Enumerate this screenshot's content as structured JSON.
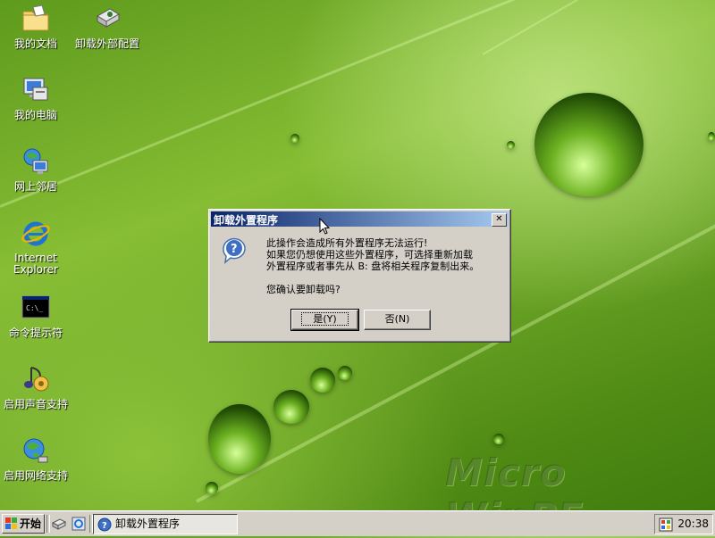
{
  "desktop": {
    "icons": [
      {
        "label": "我的文档"
      },
      {
        "label": "卸载外部配置"
      },
      {
        "label": "我的电脑"
      },
      {
        "label": "网上邻居"
      },
      {
        "label_line1": "Internet",
        "label_line2": "Explorer"
      },
      {
        "label": "命令提示符"
      },
      {
        "label": "启用声音支持"
      },
      {
        "label": "启用网络支持"
      }
    ],
    "watermark": "Micro WinPE"
  },
  "dialog": {
    "title": "卸载外置程序",
    "close_glyph": "✕",
    "message": {
      "line1": "此操作会造成所有外置程序无法运行!",
      "line2": "如果您仍想使用这些外置程序，可选择重新加载",
      "line3": "外置程序或者事先从 B: 盘将相关程序复制出来。",
      "line4": "您确认要卸载吗?"
    },
    "buttons": {
      "yes": "是(Y)",
      "no": "否(N)"
    }
  },
  "taskbar": {
    "start_label": "开始",
    "task_label": "卸载外置程序",
    "clock": "20:38"
  },
  "icons": {
    "question": "question-icon",
    "close": "close-icon"
  }
}
